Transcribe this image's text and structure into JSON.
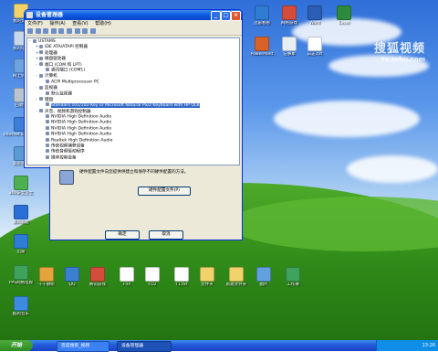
{
  "window": {
    "title": "设备管理器",
    "menu": [
      "文件(F)",
      "操作(A)",
      "查看(V)",
      "帮助(H)"
    ],
    "tree": [
      {
        "level": 0,
        "exp": "-",
        "text": "USTAMS"
      },
      {
        "level": 1,
        "exp": "+",
        "text": "IDE ATA/ATAPI 控制器"
      },
      {
        "level": 1,
        "exp": "+",
        "text": "处理器"
      },
      {
        "level": 1,
        "exp": "+",
        "text": "磁盘驱动器"
      },
      {
        "level": 1,
        "exp": "-",
        "text": "端口 (COM 和 LPT)"
      },
      {
        "level": 2,
        "exp": "",
        "text": "通讯端口 (COM1)"
      },
      {
        "level": 1,
        "exp": "-",
        "text": "计算机"
      },
      {
        "level": 2,
        "exp": "",
        "text": "ACPI Multiprocessor PC"
      },
      {
        "level": 1,
        "exp": "-",
        "text": "监视器"
      },
      {
        "level": 2,
        "exp": "",
        "text": "默认监视器"
      },
      {
        "level": 1,
        "exp": "-",
        "text": "键盘"
      },
      {
        "level": 2,
        "exp": "",
        "text": "Standard 101/102-Key or Microsoft Natural PS/2 Keyboard with HP QLB",
        "selected": true
      },
      {
        "level": 1,
        "exp": "-",
        "text": "声音、视频和游戏控制器"
      },
      {
        "level": 2,
        "exp": "",
        "text": "NVIDIA High Definition Audio"
      },
      {
        "level": 2,
        "exp": "",
        "text": "NVIDIA High Definition Audio"
      },
      {
        "level": 2,
        "exp": "",
        "text": "NVIDIA High Definition Audio"
      },
      {
        "level": 2,
        "exp": "",
        "text": "NVIDIA High Definition Audio"
      },
      {
        "level": 2,
        "exp": "",
        "text": "Realtek High Definition Audio"
      },
      {
        "level": 2,
        "exp": "",
        "text": "传统视频捕获设备"
      },
      {
        "level": 2,
        "exp": "",
        "text": "传统音频驱动程序"
      },
      {
        "level": 2,
        "exp": "",
        "text": "媒体控制设备"
      }
    ]
  },
  "dialog": {
    "text": "硬件配置文件向您提供供建立和保存不同硬件配置的方法。",
    "profile_button": "硬件配置文件(P)",
    "ok_button": "确定",
    "cancel_button": "取消"
  },
  "desktop": {
    "watermark_big": "搜狐视频",
    "watermark_small": "tv.sohu.com",
    "icons": [
      {
        "label": "我的文档",
        "color": "#f2d36b"
      },
      {
        "label": "我的电脑",
        "color": "#c9d7ea"
      },
      {
        "label": "网上邻居",
        "color": "#6fa3e0"
      },
      {
        "label": "回收站",
        "color": "#b9c4cf"
      },
      {
        "label": "Internet Explorer",
        "color": "#3b7fd9"
      },
      {
        "label": "宽带连接",
        "color": "#5b9bd5"
      },
      {
        "label": "360安全卫士",
        "color": "#4caf50"
      },
      {
        "label": "暴风影音",
        "color": "#2a6fd6"
      },
      {
        "label": "迅雷",
        "color": "#2e7cd4"
      },
      {
        "label": "PPS网络电视",
        "color": "#3fa35c"
      },
      {
        "label": "酷狗音乐",
        "color": "#3d8be0"
      },
      {
        "label": "千千静听",
        "color": "#e5a33b"
      },
      {
        "label": "QQ",
        "color": "#3a7fd0"
      },
      {
        "label": "腾讯游戏",
        "color": "#d44c3c"
      },
      {
        "label": "F04",
        "color": "#ffffff"
      },
      {
        "label": "FD2",
        "color": "#ffffff"
      },
      {
        "label": "T1.txt",
        "color": "#ffffff"
      },
      {
        "label": "文件夹",
        "color": "#f2d36b"
      },
      {
        "label": "新建文件夹",
        "color": "#f2d36b"
      },
      {
        "label": "图片",
        "color": "#62a0e0"
      },
      {
        "label": "工作簿",
        "color": "#3fa35c"
      },
      {
        "label": "迅雷看看",
        "color": "#2e7cd4"
      },
      {
        "label": "网络游戏",
        "color": "#d44c3c"
      },
      {
        "label": "Word",
        "color": "#2b5fb5"
      },
      {
        "label": "Excel",
        "color": "#2e8b3e"
      },
      {
        "label": "PowerPoint",
        "color": "#d9622b"
      },
      {
        "label": "记事本",
        "color": "#e8eef5"
      },
      {
        "label": "日志.txt",
        "color": "#ffffff"
      }
    ]
  },
  "taskbar": {
    "start": "开始",
    "tasks": [
      "百度搜索_视频",
      "设备管理器"
    ],
    "clock": "13:26"
  }
}
